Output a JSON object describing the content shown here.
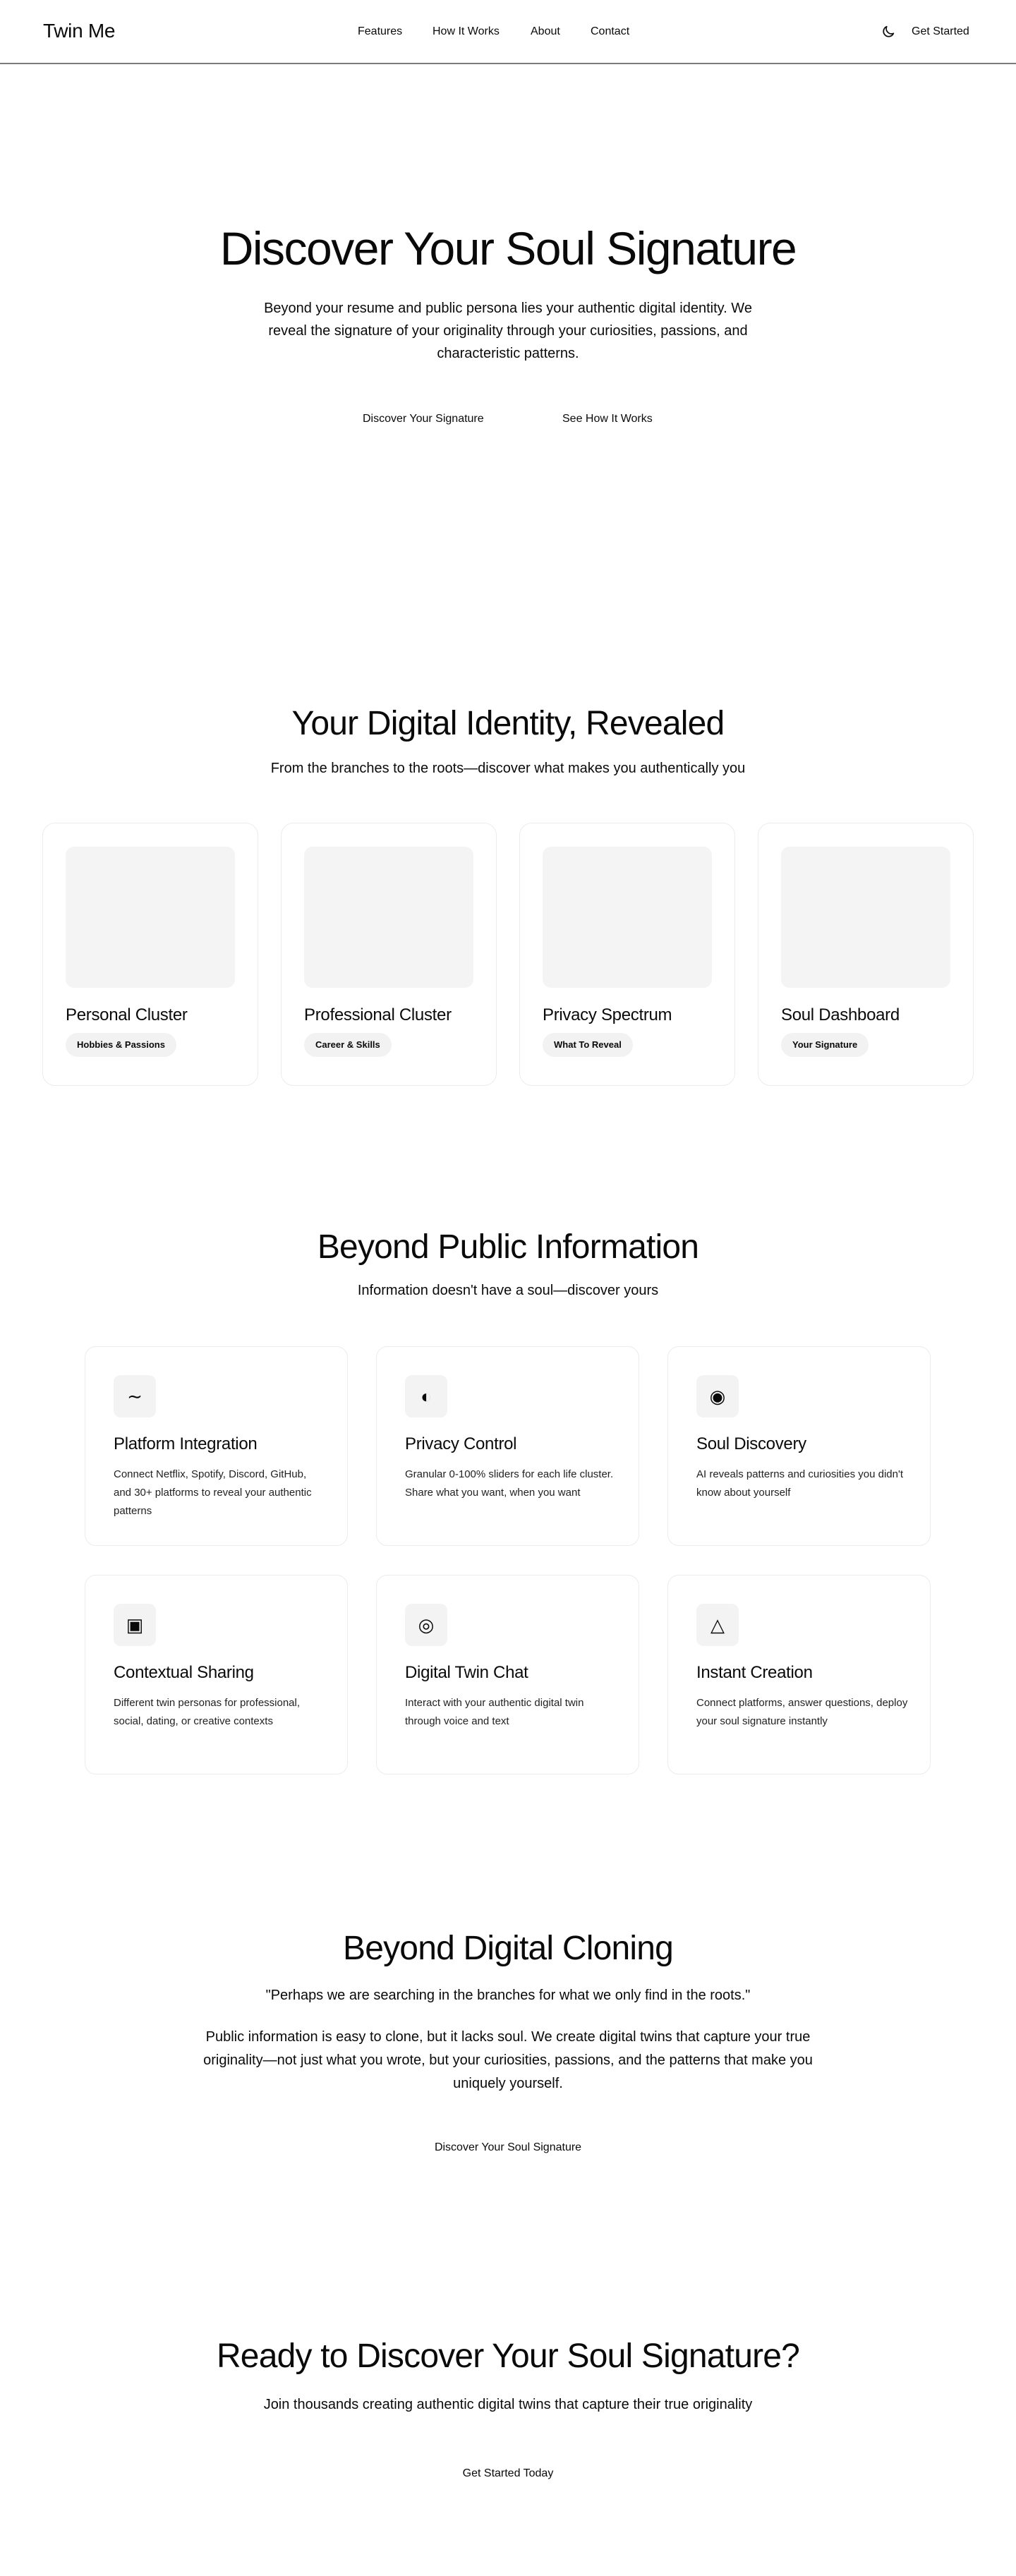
{
  "header": {
    "logo": "Twin Me",
    "nav": [
      "Features",
      "How It Works",
      "About",
      "Contact"
    ],
    "theme_icon": "moon-icon",
    "cta": "Get Started"
  },
  "hero": {
    "title": "Discover Your Soul Signature",
    "subtitle": "Beyond your resume and public persona lies your authentic digital identity. We reveal the signature of your originality through your curiosities, passions, and characteristic patterns.",
    "primary_button": "Discover Your Signature",
    "secondary_button": "See How It Works"
  },
  "identity": {
    "title": "Your Digital Identity, Revealed",
    "subtitle": "From the branches to the roots—discover what makes you authentically you",
    "cards": [
      {
        "name": "Personal Cluster",
        "tag": "Hobbies & Passions"
      },
      {
        "name": "Professional Cluster",
        "tag": "Career & Skills"
      },
      {
        "name": "Privacy Spectrum",
        "tag": "What To Reveal"
      },
      {
        "name": "Soul Dashboard",
        "tag": "Your Signature"
      }
    ]
  },
  "features": {
    "title": "Beyond Public Information",
    "subtitle": "Information doesn't have a soul—discover yours",
    "items": [
      {
        "icon": "wave-icon",
        "glyph": "∼",
        "title": "Platform Integration",
        "desc": "Connect Netflix, Spotify, Discord, GitHub, and 30+ platforms to reveal your authentic patterns"
      },
      {
        "icon": "half-circle-icon",
        "glyph": "◐",
        "title": "Privacy Control",
        "desc": "Granular 0-100% sliders for each life cluster. Share what you want, when you want"
      },
      {
        "icon": "target-icon",
        "glyph": "◉",
        "title": "Soul Discovery",
        "desc": "AI reveals patterns and curiosities you didn't know about yourself"
      },
      {
        "icon": "square-dot-icon",
        "glyph": "▣",
        "title": "Contextual Sharing",
        "desc": "Different twin personas for professional, social, dating, or creative contexts"
      },
      {
        "icon": "bullseye-icon",
        "glyph": "◎",
        "title": "Digital Twin Chat",
        "desc": "Interact with your authentic digital twin through voice and text"
      },
      {
        "icon": "triangle-icon",
        "glyph": "△",
        "title": "Instant Creation",
        "desc": "Connect platforms, answer questions, deploy your soul signature instantly"
      }
    ]
  },
  "cloning": {
    "title": "Beyond Digital Cloning",
    "quote": "\"Perhaps we are searching in the branches for what we only find in the roots.\"",
    "body": "Public information is easy to clone, but it lacks soul. We create digital twins that capture your true originality—not just what you wrote, but your curiosities, passions, and the patterns that make you uniquely yourself.",
    "button": "Discover Your Soul Signature"
  },
  "cta": {
    "title": "Ready to Discover Your Soul Signature?",
    "subtitle": "Join thousands creating authentic digital twins that capture their true originality",
    "button": "Get Started Today"
  }
}
